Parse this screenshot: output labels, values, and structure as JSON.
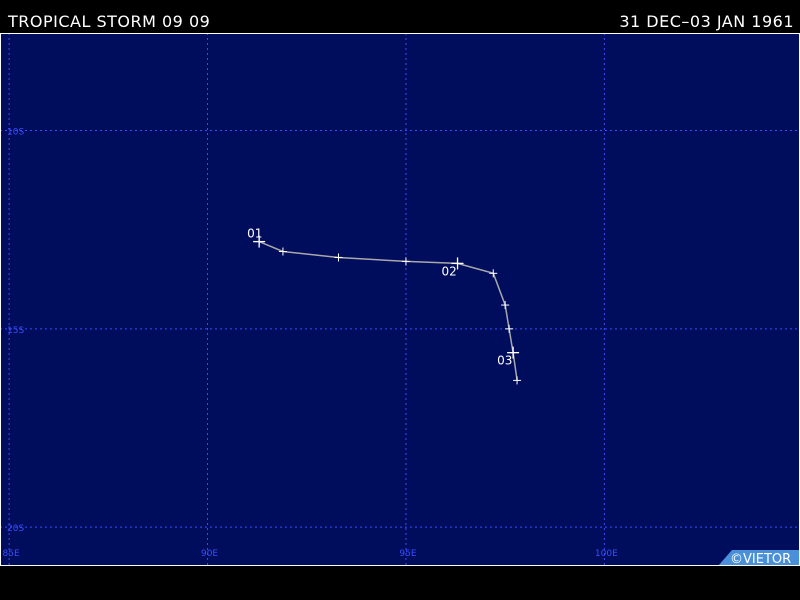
{
  "header": {
    "storm_title": "TROPICAL STORM 09 09",
    "date_range": "31 DEC–03 JAN 1961"
  },
  "map": {
    "background_color": "#000c5c",
    "grid_color": "#3a4dff",
    "track_color": "#a8a8a8",
    "label_color": "#ffffff",
    "lon_labels": [
      "85E",
      "90E",
      "95E",
      "100E"
    ],
    "lat_labels": [
      "10S",
      "15S",
      "20S"
    ],
    "lon_values": [
      85,
      90,
      95,
      100
    ],
    "lat_values": [
      -10,
      -15,
      -20
    ],
    "lon_range": [
      84.77,
      104.93
    ],
    "lat_range": [
      -7.54,
      -20.98
    ],
    "track": [
      {
        "lon": 91.3,
        "lat": -12.8
      },
      {
        "lon": 91.9,
        "lat": -13.05
      },
      {
        "lon": 93.3,
        "lat": -13.2
      },
      {
        "lon": 95.0,
        "lat": -13.3
      },
      {
        "lon": 96.3,
        "lat": -13.35
      },
      {
        "lon": 97.2,
        "lat": -13.6
      },
      {
        "lon": 97.5,
        "lat": -14.4
      },
      {
        "lon": 97.6,
        "lat": -15.0
      },
      {
        "lon": 97.7,
        "lat": -15.6
      },
      {
        "lon": 97.8,
        "lat": -16.3
      }
    ],
    "day_markers": [
      {
        "label": "01",
        "lon": 91.3,
        "lat": -12.8
      },
      {
        "label": "02",
        "lon": 96.3,
        "lat": -13.35
      },
      {
        "label": "03",
        "lon": 97.7,
        "lat": -15.6
      }
    ],
    "credit": "©VIETOR",
    "credit_bg": "#4a90d9"
  }
}
